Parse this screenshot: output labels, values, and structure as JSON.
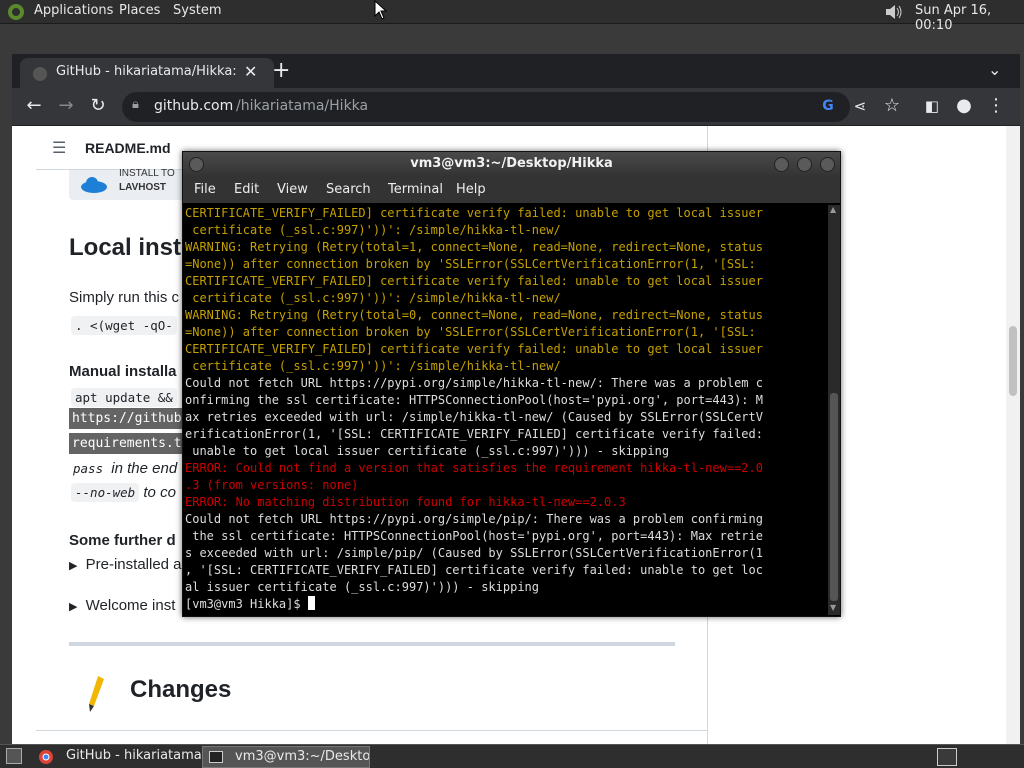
{
  "top_panel": {
    "applications": "Applications",
    "places": "Places",
    "system": "System",
    "clock": "Sun Apr 16, 00:10"
  },
  "browser": {
    "tab_title": "GitHub - hikariatama/Hikka: T",
    "url_domain": "github.com",
    "url_path": "/hikariatama/Hikka"
  },
  "page": {
    "readme_label": "README.md",
    "lavhost_line1": "INSTALL TO",
    "lavhost_line2": "LAVHOST",
    "heading_local": "Local inst",
    "simply_run": "Simply run this c",
    "wget_code": ". <(wget -qO-",
    "manual_install": "Manual installa",
    "apt_update": "apt update &&",
    "https_github": "https://github",
    "requirements": "requirements.t",
    "pass_code": "pass",
    "in_the_end": " in the end",
    "no_web_code": "--no-web",
    "to_co": " to co",
    "some_further": "Some further d",
    "preinstalled": "Pre-installed a",
    "welcome_inst": "Welcome inst",
    "changes": "Changes"
  },
  "terminal": {
    "title": "vm3@vm3:~/Desktop/Hikka",
    "menu": [
      "File",
      "Edit",
      "View",
      "Search",
      "Terminal",
      "Help"
    ],
    "lines": [
      {
        "cls": "warn",
        "text": "CERTIFICATE_VERIFY_FAILED] certificate verify failed: unable to get local issuer"
      },
      {
        "cls": "warn",
        "text": " certificate (_ssl.c:997)'))': /simple/hikka-tl-new/"
      },
      {
        "cls": "warn",
        "text": "WARNING: Retrying (Retry(total=1, connect=None, read=None, redirect=None, status"
      },
      {
        "cls": "warn",
        "text": "=None)) after connection broken by 'SSLError(SSLCertVerificationError(1, '[SSL:"
      },
      {
        "cls": "warn",
        "text": "CERTIFICATE_VERIFY_FAILED] certificate verify failed: unable to get local issuer"
      },
      {
        "cls": "warn",
        "text": " certificate (_ssl.c:997)'))': /simple/hikka-tl-new/"
      },
      {
        "cls": "warn",
        "text": "WARNING: Retrying (Retry(total=0, connect=None, read=None, redirect=None, status"
      },
      {
        "cls": "warn",
        "text": "=None)) after connection broken by 'SSLError(SSLCertVerificationError(1, '[SSL:"
      },
      {
        "cls": "warn",
        "text": "CERTIFICATE_VERIFY_FAILED] certificate verify failed: unable to get local issuer"
      },
      {
        "cls": "warn",
        "text": " certificate (_ssl.c:997)'))': /simple/hikka-tl-new/"
      },
      {
        "cls": "",
        "text": "Could not fetch URL https://pypi.org/simple/hikka-tl-new/: There was a problem c"
      },
      {
        "cls": "",
        "text": "onfirming the ssl certificate: HTTPSConnectionPool(host='pypi.org', port=443): M"
      },
      {
        "cls": "",
        "text": "ax retries exceeded with url: /simple/hikka-tl-new/ (Caused by SSLError(SSLCertV"
      },
      {
        "cls": "",
        "text": "erificationError(1, '[SSL: CERTIFICATE_VERIFY_FAILED] certificate verify failed:"
      },
      {
        "cls": "",
        "text": " unable to get local issuer certificate (_ssl.c:997)'))) - skipping"
      },
      {
        "cls": "err",
        "text": "ERROR: Could not find a version that satisfies the requirement hikka-tl-new==2.0"
      },
      {
        "cls": "err",
        "text": ".3 (from versions: none)"
      },
      {
        "cls": "err",
        "text": "ERROR: No matching distribution found for hikka-tl-new==2.0.3"
      },
      {
        "cls": "",
        "text": "Could not fetch URL https://pypi.org/simple/pip/: There was a problem confirming"
      },
      {
        "cls": "",
        "text": " the ssl certificate: HTTPSConnectionPool(host='pypi.org', port=443): Max retrie"
      },
      {
        "cls": "",
        "text": "s exceeded with url: /simple/pip/ (Caused by SSLError(SSLCertVerificationError(1"
      },
      {
        "cls": "",
        "text": ", '[SSL: CERTIFICATE_VERIFY_FAILED] certificate verify failed: unable to get loc"
      },
      {
        "cls": "",
        "text": "al issuer certificate (_ssl.c:997)'))) - skipping"
      }
    ],
    "prompt": "[vm3@vm3 Hikka]$ "
  },
  "taskbar": {
    "task1": "GitHub - hikariatama...",
    "task2": "vm3@vm3:~/Deskto..."
  },
  "colors": {
    "warn": "#c4a000",
    "err": "#cc0000"
  }
}
